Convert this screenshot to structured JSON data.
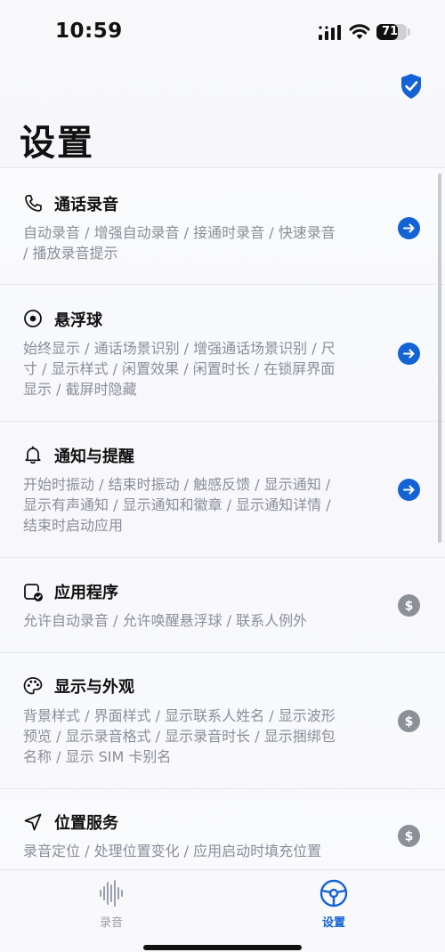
{
  "status_bar": {
    "time": "10:59",
    "battery_level": "71",
    "battery_fraction": 0.71,
    "icons": [
      "signal-icon",
      "wifi-icon",
      "battery-icon"
    ]
  },
  "header": {
    "title": "设置",
    "badge_icon": "shield-check-icon"
  },
  "colors": {
    "accent": "#1463d6",
    "paid_badge": "#8c9097",
    "description": "#8a8e98"
  },
  "settings": [
    {
      "title": "通话录音",
      "description": "自动录音 / 增强自动录音 / 接通时录音 / 快速录音 / 播放录音提示",
      "icon": "phone-icon",
      "action": "arrow-right"
    },
    {
      "title": "悬浮球",
      "description": "始终显示 / 通话场景识别 / 增强通话场景识别 / 尺寸 / 显示样式 / 闲置效果 / 闲置时长 / 在锁屏界面显示 / 截屏时隐藏",
      "icon": "target-icon",
      "action": "arrow-right"
    },
    {
      "title": "通知与提醒",
      "description": "开始时振动 / 结束时振动 / 触感反馈 / 显示通知 / 显示有声通知 / 显示通知和徽章 / 显示通知详情 / 结束时启动应用",
      "icon": "bell-icon",
      "action": "arrow-right"
    },
    {
      "title": "应用程序",
      "description": "允许自动录音 / 允许唤醒悬浮球 / 联系人例外",
      "icon": "app-check-icon",
      "action": "dollar"
    },
    {
      "title": "显示与外观",
      "description": "背景样式 / 界面样式 / 显示联系人姓名 / 显示波形预览 / 显示录音格式 / 显示录音时长 / 显示捆绑包名称 / 显示 SIM 卡别名",
      "icon": "palette-icon",
      "action": "dollar"
    },
    {
      "title": "位置服务",
      "description": "录音定位 / 处理位置变化 / 应用启动时填充位置",
      "icon": "location-arrow-icon",
      "action": "dollar"
    }
  ],
  "tab_bar": {
    "tabs": [
      {
        "label": "录音",
        "icon": "waveform-icon",
        "selected": false
      },
      {
        "label": "设置",
        "icon": "steering-wheel-icon",
        "selected": true
      }
    ]
  }
}
